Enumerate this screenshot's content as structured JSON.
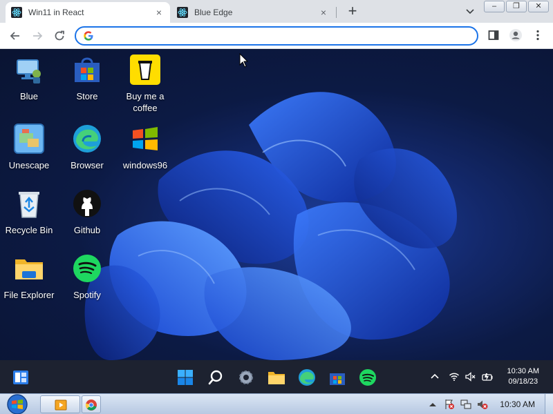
{
  "browser": {
    "tabs": [
      {
        "title": "Win11 in React",
        "active": true
      },
      {
        "title": "Blue Edge",
        "active": false
      }
    ],
    "new_tab_symbol": "+",
    "close_symbol": "×",
    "omnibox": {
      "value": "",
      "placeholder": ""
    },
    "window_controls": {
      "minimize": "–",
      "restore": "❐",
      "close": "✕"
    }
  },
  "desktop": {
    "icons": [
      {
        "label": "Blue",
        "icon": "computer-icon"
      },
      {
        "label": "Store",
        "icon": "store-icon"
      },
      {
        "label": "Buy me a coffee",
        "icon": "coffee-cup-icon"
      },
      {
        "label": "Unescape",
        "icon": "unescape-icon"
      },
      {
        "label": "Browser",
        "icon": "edge-browser-icon"
      },
      {
        "label": "windows96",
        "icon": "windows96-icon"
      },
      {
        "label": "Recycle Bin",
        "icon": "recycle-bin-icon"
      },
      {
        "label": "Github",
        "icon": "github-icon"
      },
      {
        "label": "File Explorer",
        "icon": "folder-icon"
      },
      {
        "label": "Spotify",
        "icon": "spotify-icon"
      }
    ]
  },
  "taskbar11": {
    "apps": [
      "widgets-icon",
      "start-icon",
      "search-icon",
      "settings-icon",
      "file-explorer-icon",
      "edge-icon",
      "store-icon",
      "spotify-icon"
    ],
    "tray": [
      "chevron-up-icon",
      "wifi-icon",
      "volume-muted-icon",
      "battery-icon"
    ],
    "time": "10:30 AM",
    "date": "09/18/23"
  },
  "taskbar7": {
    "pinned": [
      "media-player-icon",
      "chrome-icon"
    ],
    "tray": [
      "show-hidden-icon",
      "action-center-icon",
      "network-icon",
      "volume-icon"
    ],
    "time": "10:30 AM"
  },
  "colors": {
    "tabstrip": "#dee1e6",
    "omnibox_border": "#1a73e8",
    "taskbar11": "#1d2230",
    "accent_blue": "#1d4fd8"
  }
}
